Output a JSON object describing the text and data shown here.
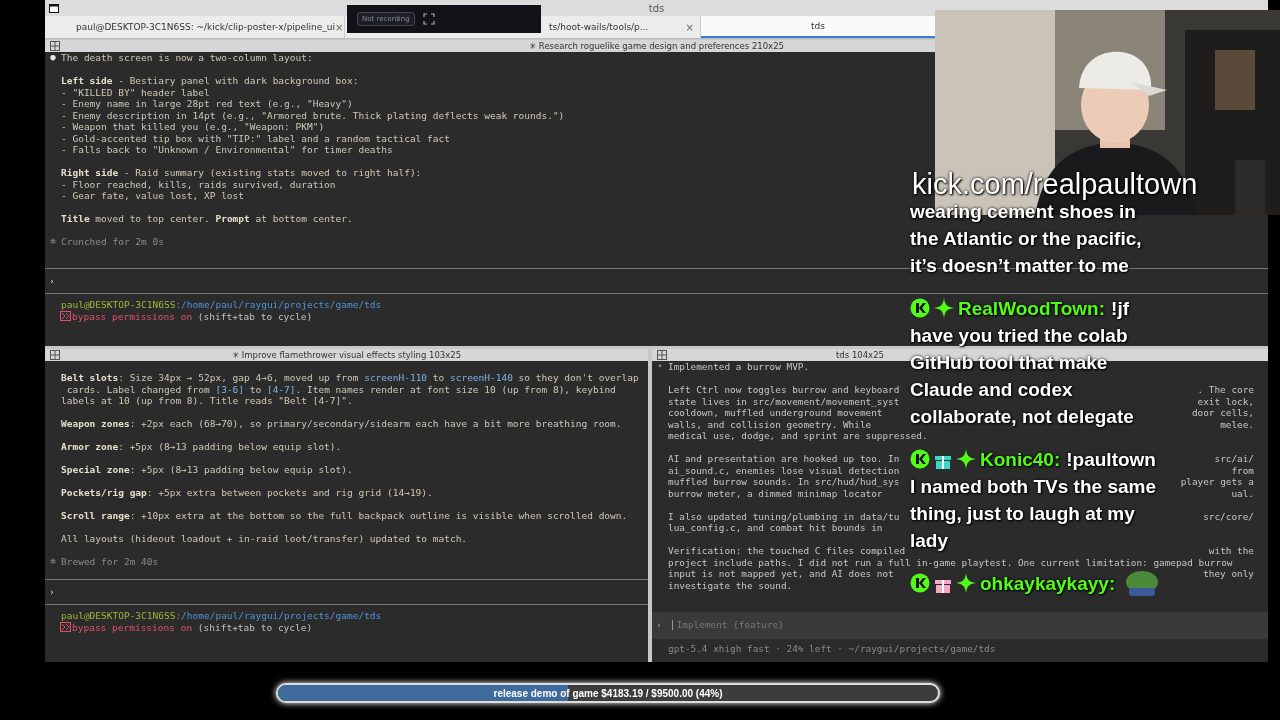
{
  "window": {
    "title": "tds"
  },
  "recording": {
    "label": "Not recording"
  },
  "tabs": [
    {
      "label": "paul@DESKTOP-3C1N6SS: ~/kick/clip-poster-x/pipeline_ui",
      "close": "×",
      "selected": false
    },
    {
      "label": "ts/hoot-wails/tools/p...",
      "close": "×",
      "selected": false
    },
    {
      "label": "tds",
      "selected": true
    }
  ],
  "top_pane": {
    "title": "✳ Research roguelike game design and preferences 210x25",
    "paragraphs": [
      [
        {
          "marker": "●",
          "segments": [
            {
              "text": "The death screen is now a two-column layout:",
              "kind": "plain"
            }
          ]
        }
      ],
      [
        {
          "segments": [
            {
              "text": "Left side",
              "kind": "bold"
            },
            {
              "text": " - Bestiary panel with dark background box:",
              "kind": "plain"
            }
          ]
        },
        {
          "segments": [
            {
              "text": "- \"KILLED BY\" header label",
              "kind": "plain"
            }
          ]
        },
        {
          "segments": [
            {
              "text": "- Enemy name in large 28pt red text (e.g., \"Heavy\")",
              "kind": "plain"
            }
          ]
        },
        {
          "segments": [
            {
              "text": "- Enemy description in 14pt (e.g., \"Armored brute. Thick plating deflects weak rounds.\")",
              "kind": "plain"
            }
          ]
        },
        {
          "segments": [
            {
              "text": "- Weapon that killed you (e.g., \"Weapon: PKM\")",
              "kind": "plain"
            }
          ]
        },
        {
          "segments": [
            {
              "text": "- Gold-accented tip box with \"TIP:\" label and a random tactical fact",
              "kind": "plain"
            }
          ]
        },
        {
          "segments": [
            {
              "text": "- Falls back to \"Unknown / Environmental\" for timer deaths",
              "kind": "plain"
            }
          ]
        }
      ],
      [
        {
          "segments": [
            {
              "text": "Right side",
              "kind": "bold"
            },
            {
              "text": " - Raid summary (existing stats moved to right half):",
              "kind": "plain"
            }
          ]
        },
        {
          "segments": [
            {
              "text": "- Floor reached, kills, raids survived, duration",
              "kind": "plain"
            }
          ]
        },
        {
          "segments": [
            {
              "text": "- Gear fate, value lost, XP lost",
              "kind": "plain"
            }
          ]
        }
      ],
      [
        {
          "segments": [
            {
              "text": "Title",
              "kind": "bold"
            },
            {
              "text": " moved to top center. ",
              "kind": "plain"
            },
            {
              "text": "Prompt",
              "kind": "bold"
            },
            {
              "text": " at bottom center.",
              "kind": "plain"
            }
          ]
        }
      ],
      [
        {
          "marker": "✻",
          "segments": [
            {
              "text": "Crunched for 2m 0s",
              "kind": "dim"
            }
          ]
        }
      ]
    ],
    "prompt": "›",
    "user": "paul@DESKTOP-3C1N6SS",
    "path": ":/home/paul/raygui/projects/game/tds",
    "mode": "bypass permissions on",
    "hint": " (shift+tab to cycle)"
  },
  "left_pane": {
    "title": "✳ Improve flamethrower visual effects styling 103x25",
    "paragraphs": [
      [
        {
          "segments": [
            {
              "text": "Belt slots",
              "kind": "bold"
            },
            {
              "text": ": Size 34px → 52px, gap 4→6, moved up from ",
              "kind": "plain"
            },
            {
              "text": "screenH-110",
              "kind": "code"
            },
            {
              "text": " to ",
              "kind": "plain"
            },
            {
              "text": "screenH-140",
              "kind": "code"
            },
            {
              "text": " so they don't overlap",
              "kind": "plain"
            }
          ]
        },
        {
          "segments": [
            {
              "text": " cards. Label changed from ",
              "kind": "plain"
            },
            {
              "text": "[3-6]",
              "kind": "code"
            },
            {
              "text": " to ",
              "kind": "plain"
            },
            {
              "text": "[4-7]",
              "kind": "code"
            },
            {
              "text": ". Item names render at font size 10 (up from 8), keybind",
              "kind": "plain"
            }
          ]
        },
        {
          "segments": [
            {
              "text": "labels at 10 (up from 8). Title reads \"Belt [4-7]\".",
              "kind": "plain"
            }
          ]
        }
      ],
      [
        {
          "segments": [
            {
              "text": "Weapon zones",
              "kind": "bold"
            },
            {
              "text": ": +2px each (68→70), so primary/secondary/sidearm each have a bit more breathing room.",
              "kind": "plain"
            }
          ]
        }
      ],
      [
        {
          "segments": [
            {
              "text": "Armor zone",
              "kind": "bold"
            },
            {
              "text": ": +5px (8→13 padding below equip slot).",
              "kind": "plain"
            }
          ]
        }
      ],
      [
        {
          "segments": [
            {
              "text": "Special zone",
              "kind": "bold"
            },
            {
              "text": ": +5px (8→13 padding below equip slot).",
              "kind": "plain"
            }
          ]
        }
      ],
      [
        {
          "segments": [
            {
              "text": "Pockets/rig gap",
              "kind": "bold"
            },
            {
              "text": ": +5px extra between pockets and rig grid (14→19).",
              "kind": "plain"
            }
          ]
        }
      ],
      [
        {
          "segments": [
            {
              "text": "Scroll range",
              "kind": "bold"
            },
            {
              "text": ": +10px extra at the bottom so the full backpack outline is visible when scrolled down.",
              "kind": "plain"
            }
          ]
        }
      ],
      [
        {
          "segments": [
            {
              "text": "All layouts (hideout loadout + in-raid loot/transfer) updated to match.",
              "kind": "plain"
            }
          ]
        }
      ],
      [
        {
          "marker": "✻",
          "segments": [
            {
              "text": "Brewed for 2m 40s",
              "kind": "dim"
            }
          ]
        }
      ]
    ],
    "prompt": "›",
    "user": "paul@DESKTOP-3C1N6SS",
    "path": ":/home/paul/raygui/projects/game/tds",
    "mode": "bypass permissions on",
    "hint": " (shift+tab to cycle)"
  },
  "right_pane": {
    "title": "tds 104x25",
    "paragraphs": [
      [
        {
          "marker": "•",
          "text": "Implemented a burrow MVP."
        }
      ],
      [
        {
          "text": "Left Ctrl now toggles burrow and keyboard",
          "tail": ". The core"
        },
        {
          "text": "state lives in src/movement/movement_syst",
          "tail": "exit lock,"
        },
        {
          "text": "cooldown, muffled underground movement",
          "tail": "door cells,"
        },
        {
          "text": "walls, and collision geometry. While",
          "tail": "melee."
        },
        {
          "text": "medical use, dodge, and sprint are suppressed."
        }
      ],
      [
        {
          "text": "AI and presentation are hooked up too. In",
          "tail": "src/ai/"
        },
        {
          "text": "ai_sound.c, enemies lose visual detection",
          "tail": "from"
        },
        {
          "text": "muffled burrow sounds. In src/hud/hud_sys",
          "tail": "player gets a"
        },
        {
          "text": "burrow meter, a dimmed minimap locator",
          "tail": "ual."
        }
      ],
      [
        {
          "text": "I also updated tuning/plumbing in data/tu",
          "tail": "src/core/"
        },
        {
          "text": "lua_config.c, and combat hit bounds in"
        }
      ],
      [
        {
          "text": "Verification: the touched C files compiled",
          "tail": "with the"
        },
        {
          "text": "project include paths. I did not run a full in-game playtest. One current limitation: gamepad burrow"
        },
        {
          "text": "input is not mapped yet, and AI does not",
          "tail": "they only"
        },
        {
          "text": "investigate the sound."
        }
      ]
    ],
    "prompt": "›",
    "placeholder": "Implement {feature}",
    "footer": "gpt-5.4 xhigh fast · 24% left · ~/raygui/projects/game/tds"
  },
  "stream": {
    "url": "kick.com/realpaultown",
    "messages": [
      {
        "text": "wearing cement shoes in the Atlantic or the pacific, it’s doesn’t matter to me"
      },
      {
        "badges": [
          {
            "kind": "kick"
          },
          {
            "kind": "sparkle"
          }
        ],
        "user": "RealWoodTown:",
        "text": "!jf have you tried the colab GitHub tool that make Claude and codex collaborate, not delegate"
      },
      {
        "badges": [
          {
            "kind": "kick"
          },
          {
            "kind": "gift",
            "color": "#3ad6c8"
          },
          {
            "kind": "sparkle"
          }
        ],
        "user": "Konic40:",
        "text": "!paultown I named both TVs the same thing, just to laugh at my lady"
      },
      {
        "badges": [
          {
            "kind": "kick"
          },
          {
            "kind": "gift",
            "color": "#f6a8c8"
          },
          {
            "kind": "sparkle"
          }
        ],
        "user": "ohkaykaykayy:",
        "emote": true
      }
    ]
  },
  "goal": {
    "label": "release demo of game $4183.19 / $9500.00 (44%)",
    "level": 0.44
  }
}
